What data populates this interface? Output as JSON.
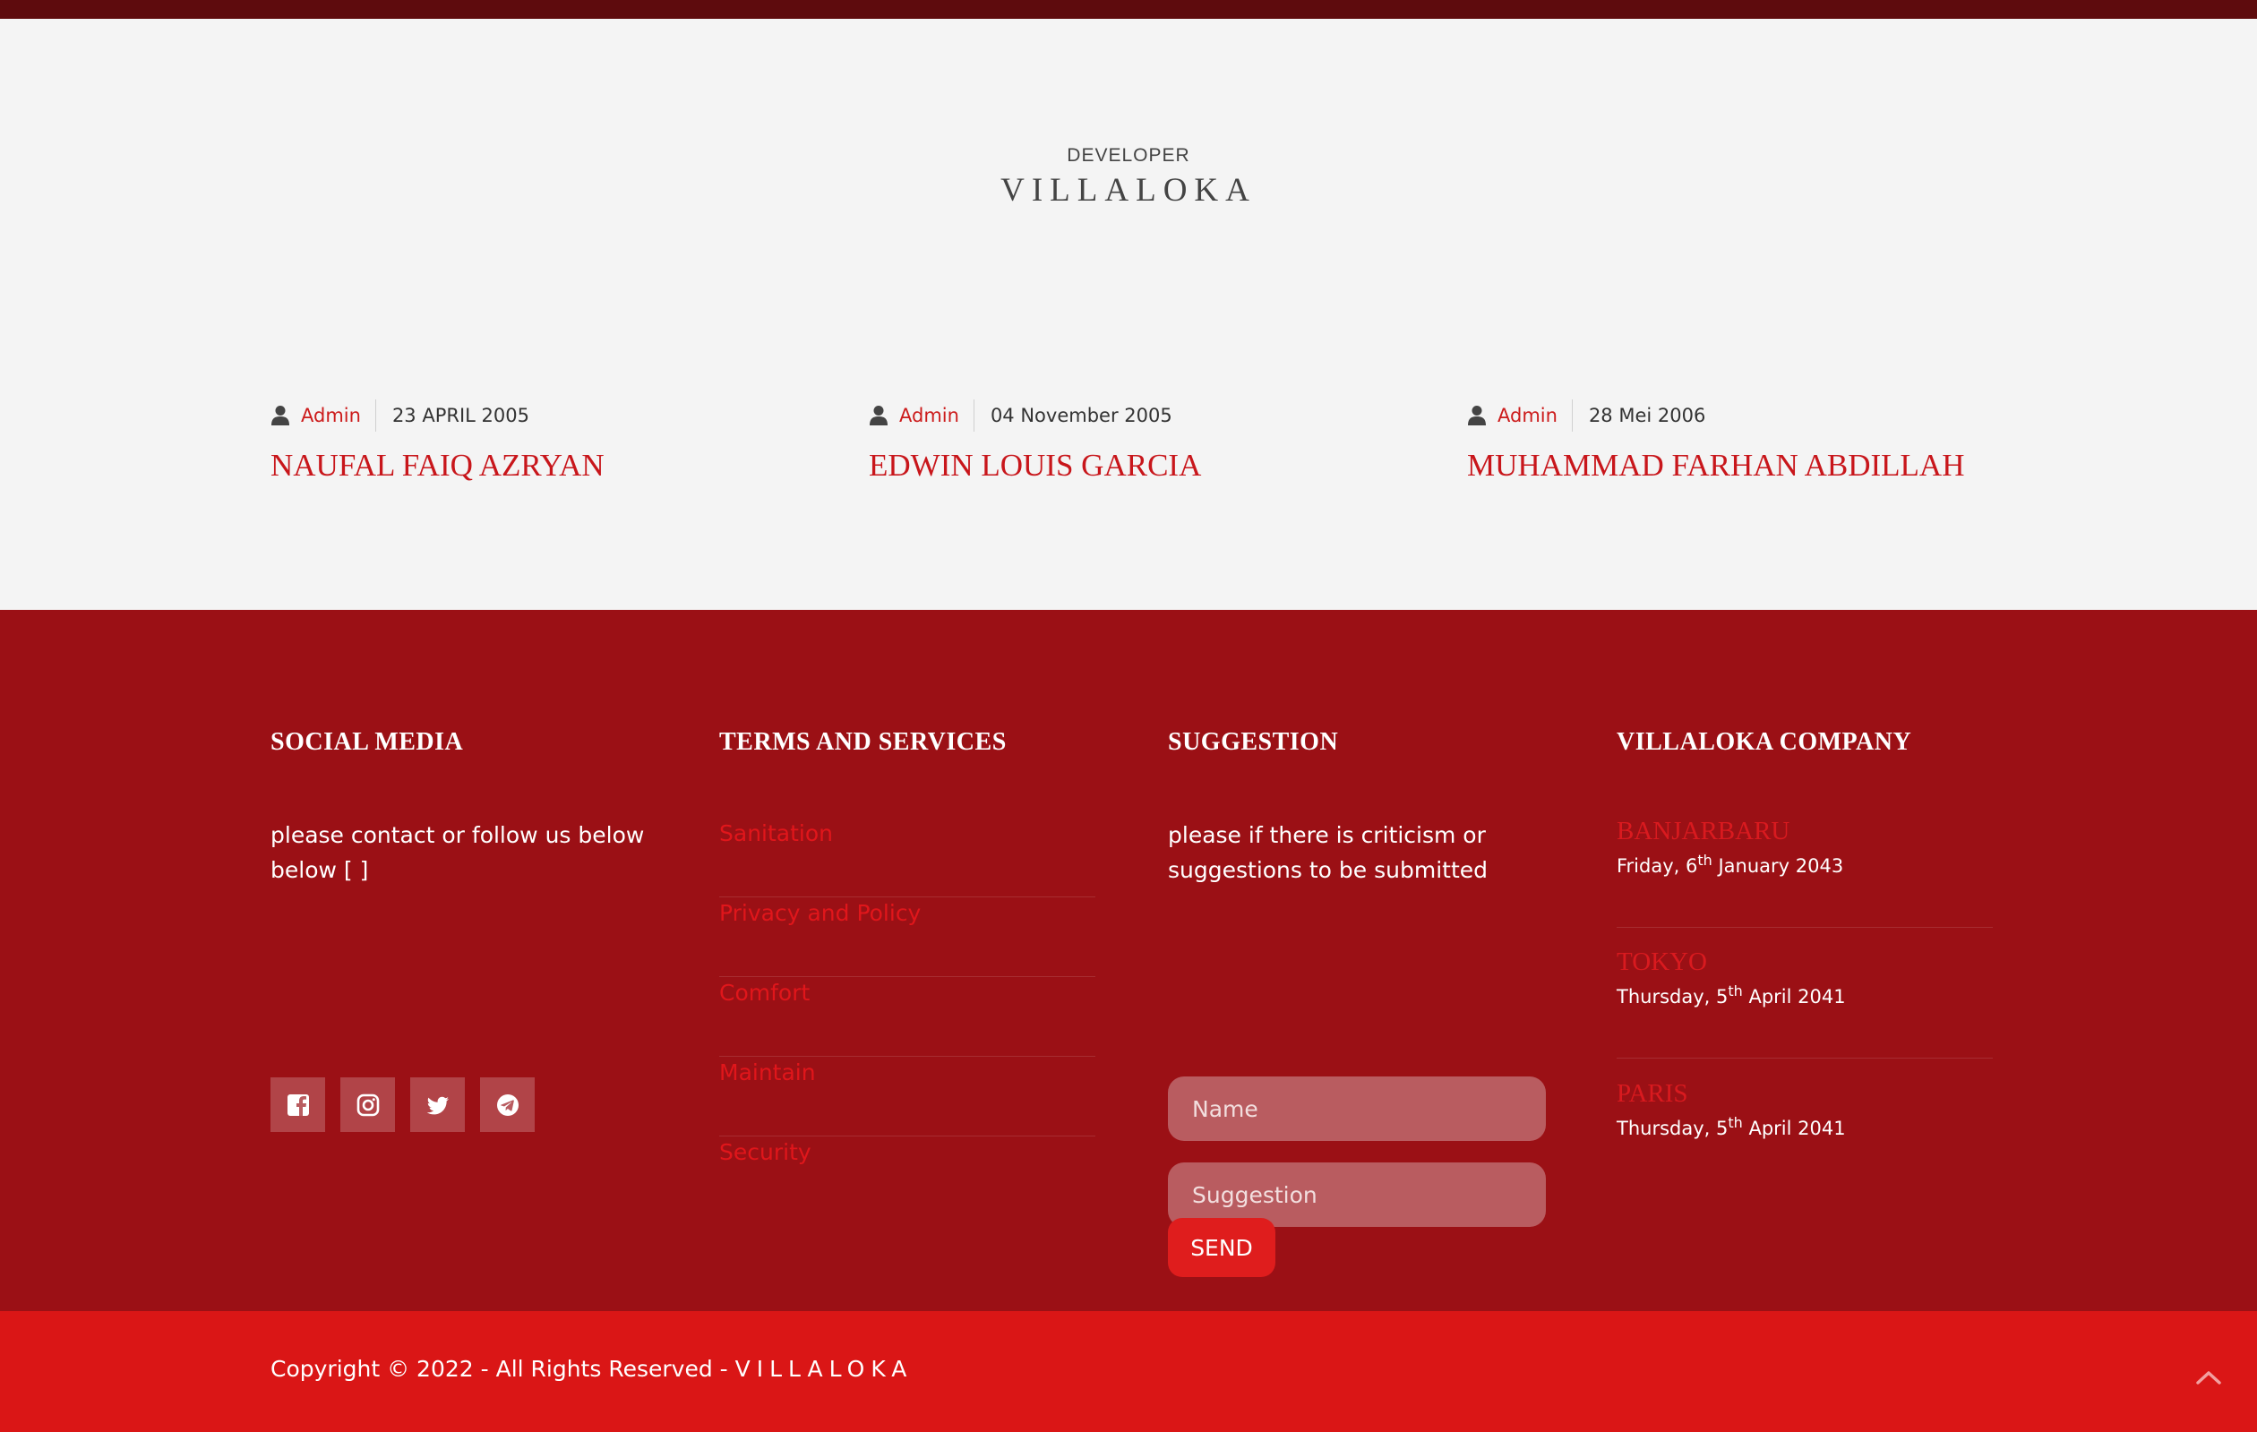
{
  "developer": {
    "subtitle": "DEVELOPER",
    "title": "VILLALOKA",
    "cards": [
      {
        "author": "Admin",
        "date": "23 APRIL 2005",
        "name": "NAUFAL FAIQ AZRYAN"
      },
      {
        "author": "Admin",
        "date": "04 November 2005",
        "name": "EDWIN LOUIS GARCIA"
      },
      {
        "author": "Admin",
        "date": "28 Mei 2006",
        "name": "MUHAMMAD FARHAN ABDILLAH"
      }
    ]
  },
  "footer": {
    "social": {
      "title": "SOCIAL MEDIA",
      "text": "please contact or follow us below below [   ]",
      "icons": [
        "facebook-icon",
        "instagram-icon",
        "twitter-icon",
        "telegram-icon"
      ]
    },
    "terms": {
      "title": "TERMS AND SERVICES",
      "items": [
        "Sanitation",
        "Privacy and Policy",
        "Comfort",
        "Maintain",
        "Security"
      ]
    },
    "suggestion": {
      "title": "SUGGESTION",
      "text": "please if there is criticism or suggestions to be submitted",
      "name_placeholder": "Name",
      "suggestion_placeholder": "Suggestion",
      "send_label": "SEND"
    },
    "company": {
      "title": "VILLALOKA COMPANY",
      "cities": [
        {
          "name": "BANJARBARU",
          "date_prefix": "Friday, 6",
          "date_sup": "th",
          "date_suffix": " January 2043"
        },
        {
          "name": "TOKYO",
          "date_prefix": "Thursday, 5",
          "date_sup": "th",
          "date_suffix": " April 2041"
        },
        {
          "name": "PARIS",
          "date_prefix": "Thursday, 5",
          "date_sup": "th",
          "date_suffix": " April 2041"
        }
      ]
    }
  },
  "bottom": {
    "copyright": "Copyright © 2022 - All Rights Reserved - ",
    "brand": "VILLALOKA"
  },
  "colors": {
    "topbar": "#5e0b0d",
    "footer": "#9b1015",
    "bottom_bar": "#da1616",
    "accent": "#c8161b"
  }
}
